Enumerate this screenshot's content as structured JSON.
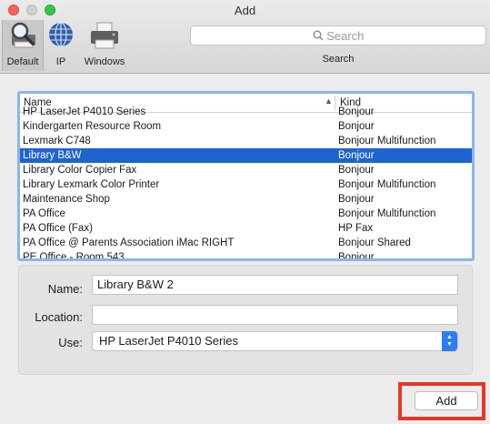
{
  "window": {
    "title": "Add"
  },
  "toolbar": {
    "tools": [
      {
        "label": "Default",
        "icon": "magnifier-printer-icon"
      },
      {
        "label": "IP",
        "icon": "globe-icon"
      },
      {
        "label": "Windows",
        "icon": "printer-icon"
      }
    ],
    "search": {
      "placeholder": "Search",
      "label": "Search"
    }
  },
  "printer_list": {
    "columns": [
      "Name",
      "Kind"
    ],
    "partial_top": {
      "name": "HP LaserJet P4010 Series",
      "kind": "Bonjour"
    },
    "rows": [
      {
        "name": "Kindergarten Resource Room",
        "kind": "Bonjour"
      },
      {
        "name": "Lexmark C748",
        "kind": "Bonjour Multifunction"
      },
      {
        "name": "Library B&W",
        "kind": "Bonjour"
      },
      {
        "name": "Library Color Copier Fax",
        "kind": "Bonjour"
      },
      {
        "name": "Library Lexmark Color Printer",
        "kind": "Bonjour Multifunction"
      },
      {
        "name": "Maintenance Shop",
        "kind": "Bonjour"
      },
      {
        "name": "PA Office",
        "kind": "Bonjour Multifunction"
      },
      {
        "name": "PA Office (Fax)",
        "kind": "HP Fax"
      },
      {
        "name": "PA Office @ Parents Association iMac RIGHT",
        "kind": "Bonjour Shared"
      },
      {
        "name": "PE Office - Room 543",
        "kind": "Bonjour"
      }
    ],
    "selected_name": "Library B&W"
  },
  "form": {
    "name_label": "Name:",
    "name_value": "Library B&W 2",
    "location_label": "Location:",
    "location_value": "",
    "use_label": "Use:",
    "use_value": "HP LaserJet P4010 Series"
  },
  "add_button": {
    "label": "Add"
  },
  "colors": {
    "selection": "#1f63d1",
    "highlight_box": "#e8352a",
    "focus_ring": "#8bb5ec"
  }
}
